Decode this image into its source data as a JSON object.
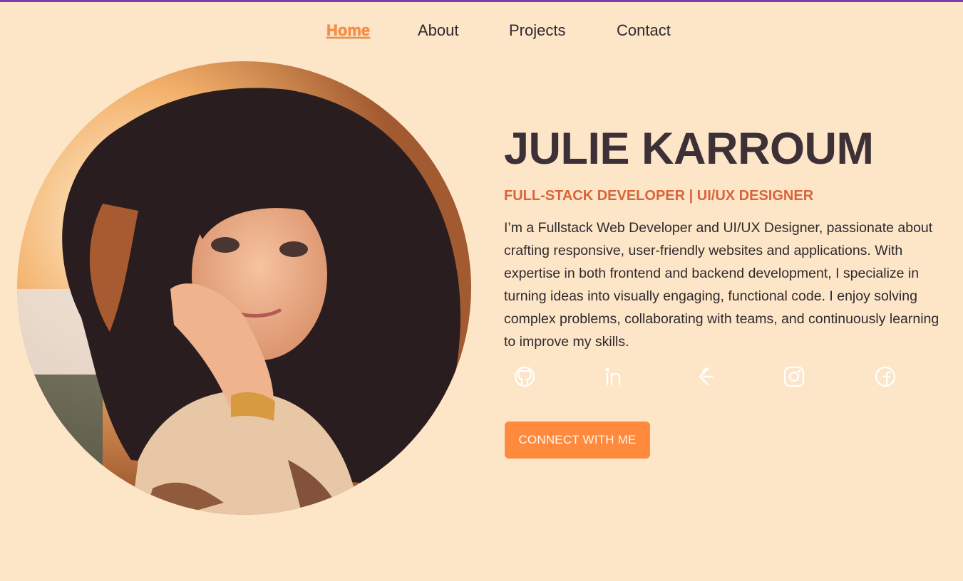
{
  "nav": {
    "items": [
      {
        "label": "Home",
        "active": true
      },
      {
        "label": "About",
        "active": false
      },
      {
        "label": "Projects",
        "active": false
      },
      {
        "label": "Contact",
        "active": false
      }
    ]
  },
  "hero": {
    "name": "JULIE KARROUM",
    "role": "FULL-STACK DEVELOPER | UI/UX DESIGNER",
    "bio": "I’m a Fullstack Web Developer and UI/UX Designer, passionate about crafting responsive, user-friendly websites and applications. With expertise in both frontend and backend development, I specialize in turning ideas into visually engaging, functional code. I enjoy solving complex problems, collaborating with teams, and continuously learning to improve my skills.",
    "cta_label": "CONNECT WITH ME"
  },
  "socials": [
    {
      "icon": "github-icon"
    },
    {
      "icon": "linkedin-icon"
    },
    {
      "icon": "leetcode-icon"
    },
    {
      "icon": "instagram-icon"
    },
    {
      "icon": "facebook-icon"
    }
  ],
  "colors": {
    "background": "#fde5c8",
    "accent": "#ff8a3d",
    "heading": "#3d3137",
    "role": "#d9643a",
    "topbar": "#7b3fb3"
  }
}
